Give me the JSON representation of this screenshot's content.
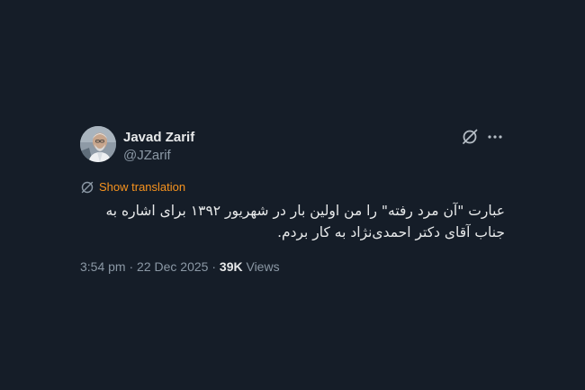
{
  "tweet": {
    "author": {
      "display_name": "Javad Zarif",
      "handle": "@JZarif",
      "avatar_icon": "user-avatar-photo"
    },
    "actions": {
      "grok_icon": "grok-icon",
      "more_icon": "more-options-icon"
    },
    "translate": {
      "icon": "translate-icon",
      "label": "Show translation",
      "color": "#f7931e"
    },
    "text": "عبارت \"آن مرد رفته\" را من اولین بار در شهریور ۱۳۹۲ برای اشاره به جناب آقای دکتر احمدی‌نژاد به کار بردم.",
    "time": "3:54 pm",
    "separator": " · ",
    "date": "22 Dec 2025",
    "views_count": "39K",
    "views_label": " Views"
  },
  "colors": {
    "background": "#151d28",
    "primary_text": "#e7e9ea",
    "secondary_text": "#8b98a5",
    "accent": "#f7931e"
  }
}
